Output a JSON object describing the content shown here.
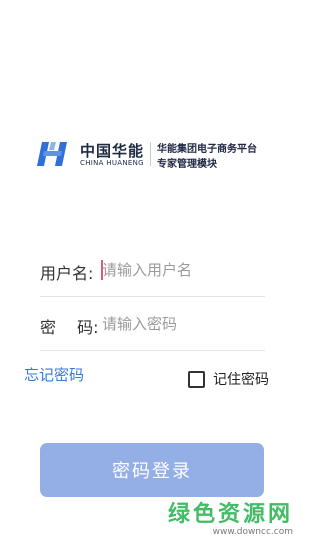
{
  "brand": {
    "name_cn": "中国华能",
    "name_en": "CHINA HUANENG",
    "subtitle_line1": "华能集团电子商务平台",
    "subtitle_line2": "专家管理模块",
    "logo_color": "#2f6fd6"
  },
  "form": {
    "username_label": "用户名:",
    "username_placeholder": "请输入用户名",
    "username_value": "",
    "password_label": "密　 码:",
    "password_placeholder": "请输入密码",
    "password_value": "",
    "forgot_label": "忘记密码",
    "remember_label": "记住密码",
    "remember_checked": false,
    "login_label": "密码登录"
  },
  "watermark": {
    "text": "绿色资源网",
    "url": "www.downcc.com"
  },
  "colors": {
    "accent": "#3a7bd5",
    "login_button": "#94aee6",
    "watermark": "#22b14c"
  }
}
